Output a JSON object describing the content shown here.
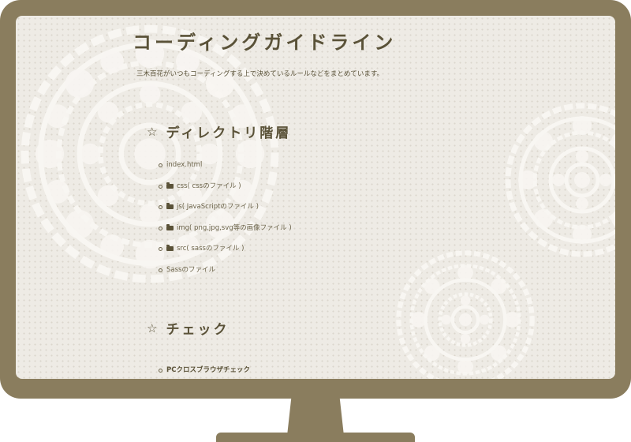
{
  "page": {
    "title": "コーディングガイドライン",
    "intro": "三木百花がいつもコーディングする上で決めているルールなどをまとめています。"
  },
  "sections": [
    {
      "title": "ディレクトリ階層",
      "icon": "star-outline-icon",
      "items": [
        {
          "label": "index.html",
          "folder": false
        },
        {
          "label": "css( cssのファイル )",
          "folder": true
        },
        {
          "label": "js( JavaScriptのファイル )",
          "folder": true
        },
        {
          "label": "img( png,jpg,svg等の画像ファイル )",
          "folder": true
        },
        {
          "label": "src( sassのファイル )",
          "folder": true
        },
        {
          "label": "Sassのファイル",
          "folder": false
        }
      ]
    },
    {
      "title": "チェック",
      "icon": "star-outline-icon",
      "items": [
        {
          "label": "PCクロスブラウザチェック",
          "folder": false
        }
      ]
    }
  ],
  "colors": {
    "frame": "#8a7d5e",
    "screen": "#eeebe5",
    "text": "#5a5238",
    "doily": "#f8f6f2"
  }
}
